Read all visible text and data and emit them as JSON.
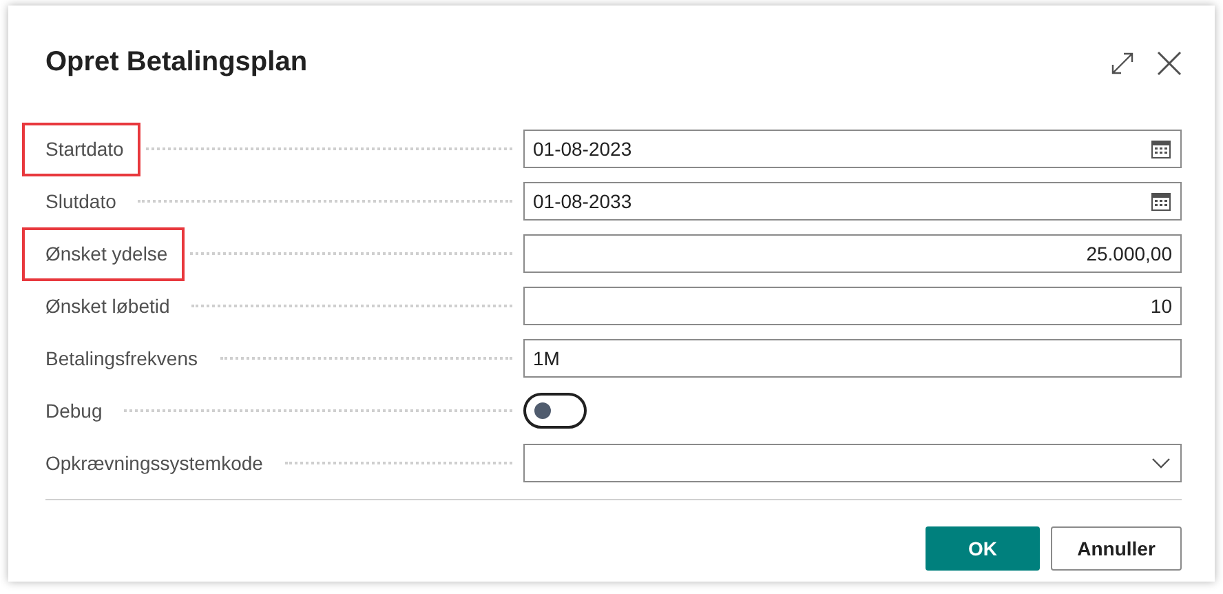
{
  "dialog": {
    "title": "Opret Betalingsplan"
  },
  "fields": [
    {
      "label": "Startdato",
      "kind": "date",
      "value": "01-08-2023",
      "highlighted": true
    },
    {
      "label": "Slutdato",
      "kind": "date",
      "value": "01-08-2033",
      "highlighted": false
    },
    {
      "label": "Ønsket ydelse",
      "kind": "number",
      "value": "25.000,00",
      "highlighted": true
    },
    {
      "label": "Ønsket løbetid",
      "kind": "number",
      "value": "10",
      "highlighted": false
    },
    {
      "label": "Betalingsfrekvens",
      "kind": "text",
      "value": "1M",
      "highlighted": false
    },
    {
      "label": "Debug",
      "kind": "toggle",
      "on": false,
      "highlighted": false
    },
    {
      "label": "Opkrævningssystemkode",
      "kind": "select",
      "highlighted": false
    }
  ],
  "buttons": [
    {
      "label": "OK",
      "kind": "primary"
    },
    {
      "label": "Annuller",
      "kind": "secondary"
    }
  ]
}
